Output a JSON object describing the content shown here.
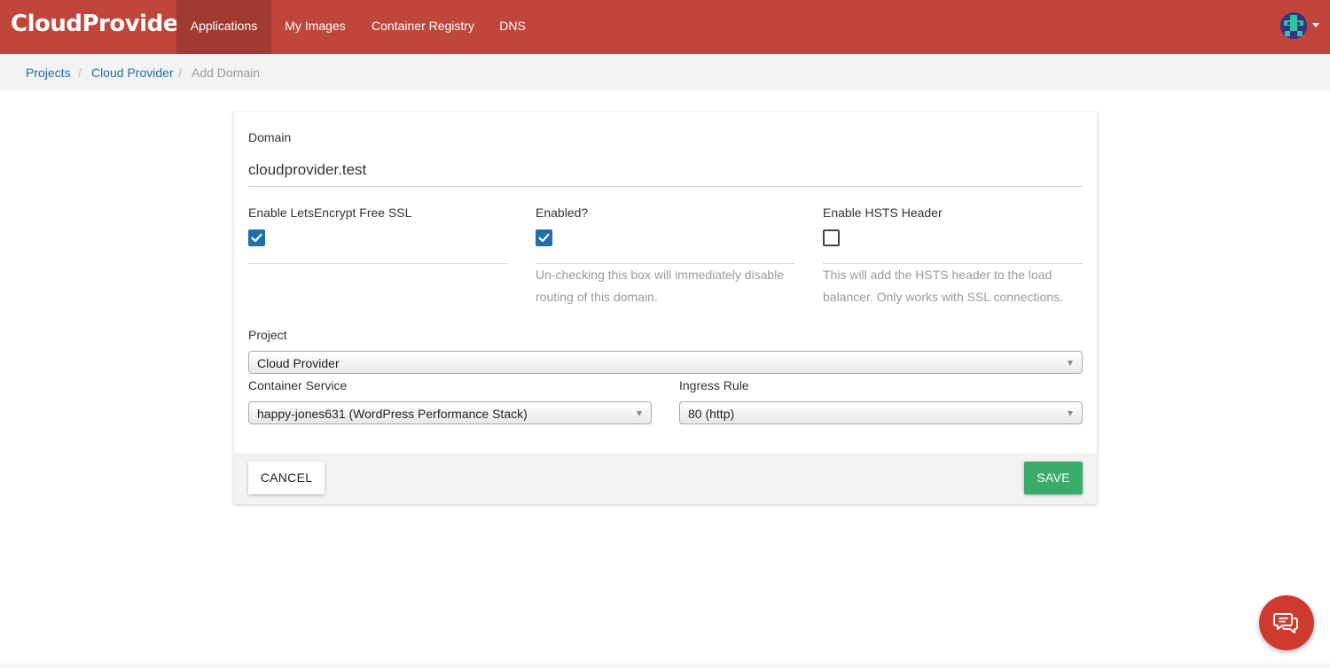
{
  "brand": {
    "name": "CloudProvider"
  },
  "nav": {
    "tabs": [
      {
        "label": "Applications",
        "active": true
      },
      {
        "label": "My Images",
        "active": false
      },
      {
        "label": "Container Registry",
        "active": false
      },
      {
        "label": "DNS",
        "active": false
      }
    ]
  },
  "breadcrumb": {
    "items": [
      {
        "label": "Projects"
      },
      {
        "label": "Cloud Provider"
      },
      {
        "label": "Add Domain"
      }
    ],
    "separator": "/"
  },
  "form": {
    "domain": {
      "label": "Domain",
      "value": "cloudprovider.test"
    },
    "letsencrypt": {
      "label": "Enable LetsEncrypt Free SSL",
      "checked": true
    },
    "enabled": {
      "label": "Enabled?",
      "checked": true,
      "help": "Un-checking this box will immediately disable routing of this domain."
    },
    "hsts": {
      "label": "Enable HSTS Header",
      "checked": false,
      "help": "This will add the HSTS header to the load balancer. Only works with SSL connections."
    },
    "project": {
      "label": "Project",
      "value": "Cloud Provider"
    },
    "container_service": {
      "label": "Container Service",
      "value": "happy-jones631 (WordPress Performance Stack)"
    },
    "ingress_rule": {
      "label": "Ingress Rule",
      "value": "80 (http)"
    },
    "cancel_label": "CANCEL",
    "save_label": "SAVE"
  },
  "colors": {
    "nav_bg": "#c0453a",
    "nav_active_bg": "#a13a30",
    "link": "#1f6fa8",
    "checkbox_on": "#1f6fa8",
    "save_button": "#3bab6a",
    "chat_button": "#cf3a2e"
  },
  "icons": {
    "avatar": "user-avatar-icon",
    "avatar_caret": "chevron-down-icon",
    "checkmark": "check-icon",
    "chat": "chat-bubbles-icon"
  }
}
